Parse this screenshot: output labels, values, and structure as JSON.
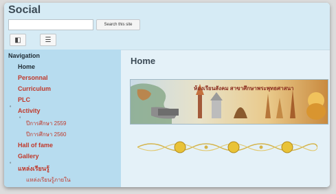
{
  "site": {
    "title": "Social"
  },
  "search": {
    "placeholder": "",
    "value": "",
    "button_label": "Search this site"
  },
  "toolbar": {
    "buttons": [
      {
        "icon": "sidebar-toggle-icon",
        "glyph": "◧"
      },
      {
        "icon": "menu-icon",
        "glyph": "☰"
      }
    ]
  },
  "sidebar": {
    "title": "Navigation",
    "items": [
      {
        "label": "Home"
      },
      {
        "label": "Personnal"
      },
      {
        "label": "Curriculum"
      },
      {
        "label": "PLC"
      },
      {
        "label": "Activity"
      },
      {
        "label": "ปีการศึกษา 2559"
      },
      {
        "label": "ปีการศึกษา 2560"
      },
      {
        "label": "Hall of fame"
      },
      {
        "label": "Gallery"
      },
      {
        "label": "แหล่งเรียนรู้"
      },
      {
        "label": "แหล่งเรียนรู้ภายใน"
      }
    ],
    "bullet_glyph": "˚"
  },
  "main": {
    "page_title": "Home",
    "banner": {
      "text": "ห้องเรียนสังคม สาขาศึกษาพระพุทธศาสนา"
    }
  },
  "colors": {
    "background": "#d6ebf5",
    "sidebar": "#b7dcef",
    "nav_link": "#c0392b",
    "heading": "#3b4a55"
  }
}
